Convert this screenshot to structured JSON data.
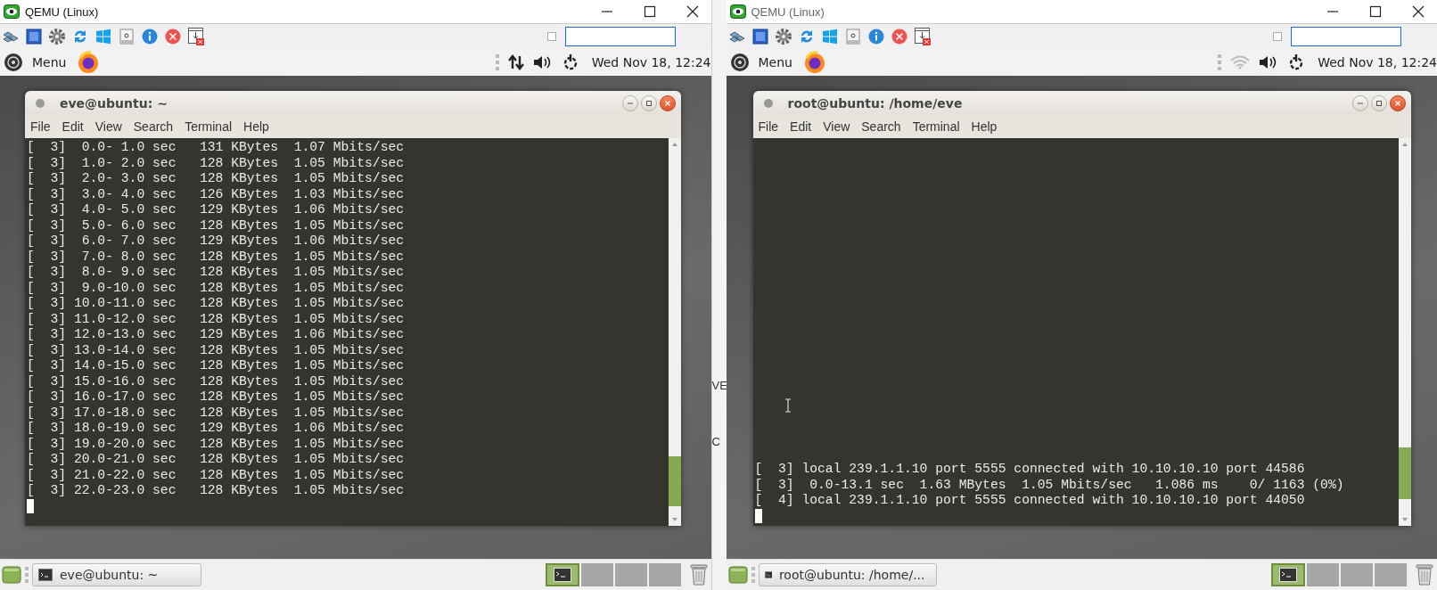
{
  "screens": [
    {
      "window": {
        "title": "QEMU (Linux)"
      },
      "toolbar": {
        "checkbox": {
          "checked": false
        }
      },
      "panel": {
        "menu": "Menu",
        "tray": [
          {
            "kind": "transfer"
          },
          {
            "kind": "volume"
          },
          {
            "kind": "power"
          }
        ],
        "clock": "Wed Nov 18, 12:24"
      },
      "terminal": {
        "title": "eve@ubuntu: ~",
        "menu": [
          "File",
          "Edit",
          "View",
          "Search",
          "Terminal",
          "Help"
        ],
        "lines": [
          "[  3]  0.0- 1.0 sec   131 KBytes  1.07 Mbits/sec",
          "[  3]  1.0- 2.0 sec   128 KBytes  1.05 Mbits/sec",
          "[  3]  2.0- 3.0 sec   128 KBytes  1.05 Mbits/sec",
          "[  3]  3.0- 4.0 sec   126 KBytes  1.03 Mbits/sec",
          "[  3]  4.0- 5.0 sec   129 KBytes  1.06 Mbits/sec",
          "[  3]  5.0- 6.0 sec   128 KBytes  1.05 Mbits/sec",
          "[  3]  6.0- 7.0 sec   129 KBytes  1.06 Mbits/sec",
          "[  3]  7.0- 8.0 sec   128 KBytes  1.05 Mbits/sec",
          "[  3]  8.0- 9.0 sec   128 KBytes  1.05 Mbits/sec",
          "[  3]  9.0-10.0 sec   128 KBytes  1.05 Mbits/sec",
          "[  3] 10.0-11.0 sec   128 KBytes  1.05 Mbits/sec",
          "[  3] 11.0-12.0 sec   128 KBytes  1.05 Mbits/sec",
          "[  3] 12.0-13.0 sec   129 KBytes  1.06 Mbits/sec",
          "[  3] 13.0-14.0 sec   128 KBytes  1.05 Mbits/sec",
          "[  3] 14.0-15.0 sec   128 KBytes  1.05 Mbits/sec",
          "[  3] 15.0-16.0 sec   128 KBytes  1.05 Mbits/sec",
          "[  3] 16.0-17.0 sec   128 KBytes  1.05 Mbits/sec",
          "[  3] 17.0-18.0 sec   128 KBytes  1.05 Mbits/sec",
          "[  3] 18.0-19.0 sec   129 KBytes  1.06 Mbits/sec",
          "[  3] 19.0-20.0 sec   128 KBytes  1.05 Mbits/sec",
          "[  3] 20.0-21.0 sec   128 KBytes  1.05 Mbits/sec",
          "[  3] 21.0-22.0 sec   128 KBytes  1.05 Mbits/sec",
          "[  3] 22.0-23.0 sec   128 KBytes  1.05 Mbits/sec"
        ]
      },
      "taskbar": {
        "task": "eve@ubuntu: ~"
      }
    },
    {
      "window": {
        "title": "QEMU (Linux)"
      },
      "toolbar": {
        "checkbox": {
          "checked": false
        }
      },
      "panel": {
        "menu": "Menu",
        "tray": [
          {
            "kind": "wifi"
          },
          {
            "kind": "volume"
          },
          {
            "kind": "power"
          }
        ],
        "clock": "Wed Nov 18, 12:24"
      },
      "terminal": {
        "title": "root@ubuntu: /home/eve",
        "menu": [
          "File",
          "Edit",
          "View",
          "Search",
          "Terminal",
          "Help"
        ],
        "lines": [
          "[  3] local 239.1.1.10 port 5555 connected with 10.10.10.10 port 44586",
          "[  3]  0.0-13.1 sec  1.63 MBytes  1.05 Mbits/sec   1.086 ms    0/ 1163 (0%)",
          "[  4] local 239.1.1.10 port 5555 connected with 10.10.10.10 port 44050"
        ]
      },
      "taskbar": {
        "task": "root@ubuntu: /home/..."
      }
    }
  ],
  "background_fragments": [
    "VE",
    "C"
  ]
}
